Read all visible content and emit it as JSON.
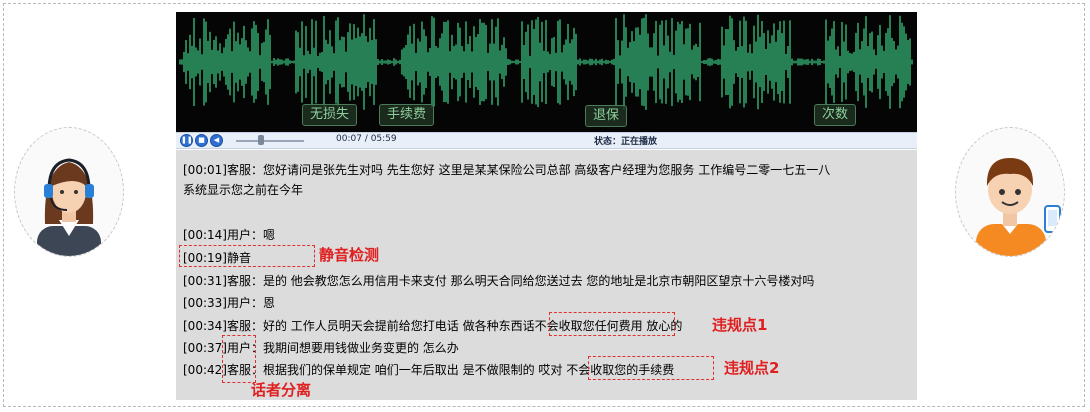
{
  "waveform": {
    "tags": [
      "无损失",
      "手续费",
      "退保",
      "次数"
    ]
  },
  "player": {
    "time": "00:07 / 05:59",
    "status": "状态：正在播放",
    "play_icon": "pause-icon",
    "stop_icon": "stop-icon",
    "volume_icon": "volume-icon"
  },
  "transcript": {
    "lines": [
      "[00:01]客服：您好请问是张先生对吗 先生您好 这里是某某保险公司总部 高级客户经理为您服务 工作编号二零一七五一八",
      "系统显示您之前在今年",
      "[00:14]用户：嗯",
      "[00:19]静音",
      "[00:31]客服：是的 他会教您怎么用信用卡来支付 那么明天合同给您送过去 您的地址是北京市朝阳区望京十六号楼对吗",
      "[00:33]用户：恩",
      "[00:34]客服：好的 工作人员明天会提前给您打电话 做各种东西话不会收取您任何费用 放心的",
      "[00:37]用户：我期间想要用钱做业务变更的 怎么办",
      "[00:42]客服：根据我们的保单规定 咱们一年后取出 是不做限制的 哎对 不会收取您的手续费"
    ]
  },
  "annotations": {
    "silence": "静音检测",
    "violation1": "违规点1",
    "violation2": "违规点2",
    "speaker": "话者分离"
  },
  "colors": {
    "wave": "#3ed18a",
    "annotation": "#e02020",
    "transcript_bg": "#dcdcdc"
  }
}
